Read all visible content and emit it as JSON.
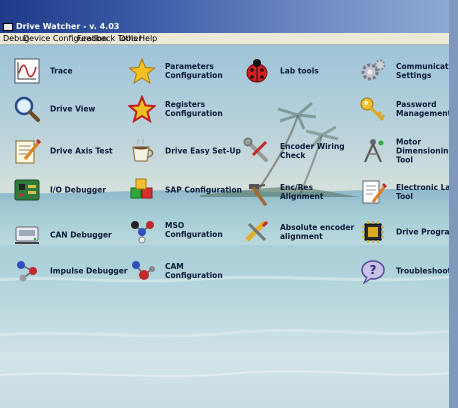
{
  "window": {
    "title": "Drive Watcher - v. 4.03"
  },
  "menu": [
    "Debug",
    "Device Configuration",
    "Feedback Tools",
    "Other",
    "Help"
  ],
  "tools": {
    "trace": "Trace",
    "drive_view": "Drive View",
    "drive_axis_test": "Drive Axis Test",
    "io_debugger": "I/O Debugger",
    "can_debugger": "CAN Debugger",
    "impulse_debugger": "Impulse Debugger",
    "parameters_configuration": "Parameters\nConfiguration",
    "registers_configuration": "Registers\nConfiguration",
    "drive_easy_setup": "Drive Easy Set-Up",
    "sap_configuration": "SAP Configuration",
    "mso_configuration": "MSO Configuration",
    "cam_configuration": "CAM Configuration",
    "lab_tools": "Lab tools",
    "encoder_wiring_check": "Encoder Wiring\nCheck",
    "enc_res_alignment": "Enc/Res\nAlignment",
    "absolute_encoder_alignment": "Absolute encoder\nalignment",
    "communication_settings": "Communication\nSettings",
    "password_management": "Password\nManagement",
    "motor_dimensioning_tool": "Motor\nDimensioning\nTool",
    "electronic_label_tool": "Electronic Label\nTool",
    "drive_programmer": "Drive Programmer",
    "troubleshooting": "Troubleshooting"
  }
}
